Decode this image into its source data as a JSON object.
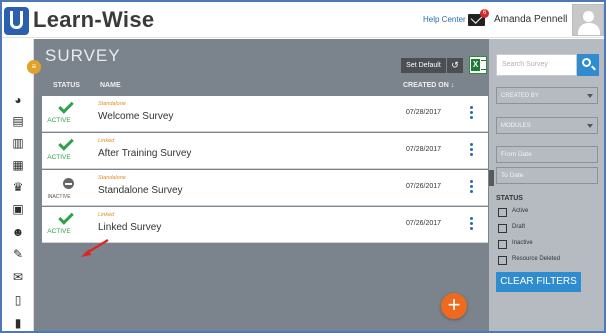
{
  "header": {
    "logo_text": "Learn-Wise",
    "help_label": "Help Center",
    "mail_count": "6",
    "user_name": "Amanda Pennell"
  },
  "page": {
    "title": "SURVEY",
    "set_default_label": "Set Default"
  },
  "table": {
    "columns": {
      "status": "STATUS",
      "name": "NAME",
      "created_on": "CREATED ON ↓"
    },
    "rows": [
      {
        "status": "ACTIVE",
        "type": "Standalone",
        "name": "Welcome Survey",
        "created_on": "07/28/2017"
      },
      {
        "status": "ACTIVE",
        "type": "Linked",
        "name": "After Training Survey",
        "created_on": "07/28/2017"
      },
      {
        "status": "INACTIVE",
        "type": "Standalone",
        "name": "Standalone Survey",
        "created_on": "07/26/2017"
      },
      {
        "status": "ACTIVE",
        "type": "Linked",
        "name": "Linked Survey",
        "created_on": "07/26/2017"
      }
    ]
  },
  "filters": {
    "search_placeholder": "Search Survey",
    "created_by_label": "CREATED BY",
    "modules_label": "MODULES",
    "from_date_placeholder": "From Date",
    "to_date_placeholder": "To Date",
    "status_heading": "STATUS",
    "status_options": [
      "Active",
      "Draft",
      "Inactive",
      "Resource Deleted"
    ],
    "clear_label": "CLEAR FILTERS"
  },
  "colors": {
    "active_green": "#2fa14a",
    "accent_blue": "#2e8ccf",
    "fab_orange": "#ef6a1f",
    "type_orange": "#e38b1f"
  }
}
